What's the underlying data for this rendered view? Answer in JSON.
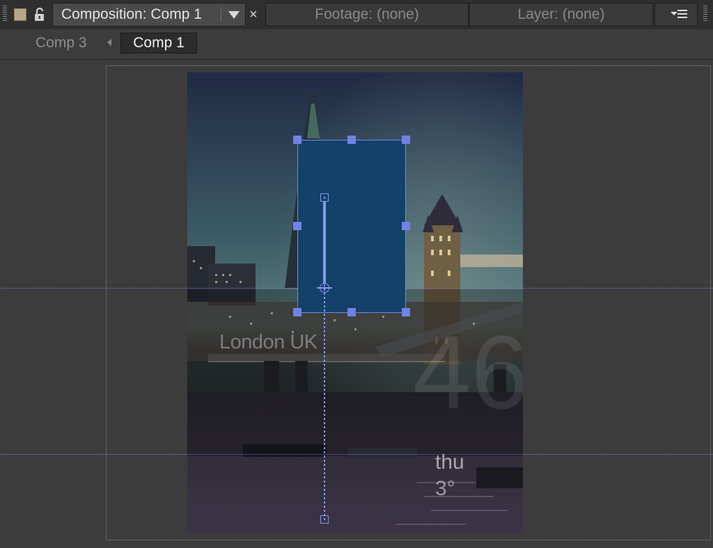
{
  "tabs": {
    "composition": "Composition: Comp 1",
    "footage": "Footage: (none)",
    "layer": "Layer: (none)",
    "close_glyph": "×"
  },
  "breadcrumb": {
    "items": [
      "Comp 3",
      "Comp 1"
    ],
    "active": "Comp 1"
  },
  "composition_overlay": {
    "city": "London UK",
    "big_temperature": "46",
    "day": "thu",
    "low_temperature": "3°"
  },
  "colors": {
    "accent_handle": "#7082e6",
    "layer_fill": "#13416a",
    "label_swatch": "#bba588",
    "guide": "#6b76c0"
  },
  "icons": [
    "panel-grip-icon",
    "label-color-swatch",
    "lock-icon",
    "dropdown-arrow-icon",
    "close-icon",
    "panel-menu-icon",
    "breadcrumb-arrow-icon"
  ]
}
